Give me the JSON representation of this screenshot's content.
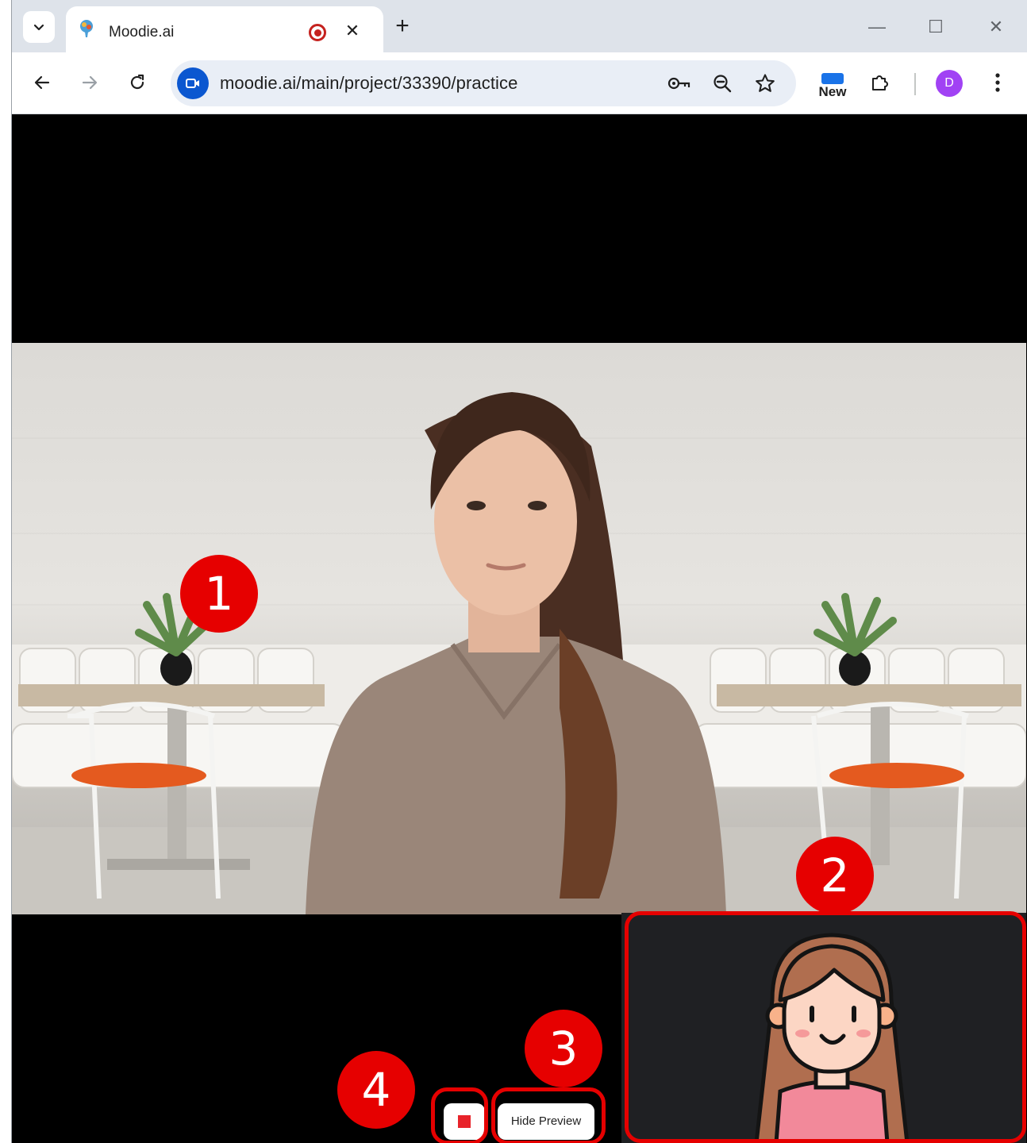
{
  "browser": {
    "tab": {
      "title": "Moodie.ai",
      "close_glyph": "✕"
    },
    "new_tab_glyph": "+",
    "window_controls": {
      "minimize": "—",
      "maximize": "☐",
      "close": "✕"
    },
    "toolbar": {
      "url": "moodie.ai/main/project/33390/practice",
      "new_badge_label": "New",
      "profile_initial": "D"
    }
  },
  "annotations": {
    "marker_1": "1",
    "marker_2": "2",
    "marker_3": "3",
    "marker_4": "4"
  },
  "video_controls": {
    "hide_preview_label": "Hide Preview"
  },
  "colors": {
    "annotation_red": "#e60000",
    "stop_red": "#e8232a",
    "site_badge_blue": "#0b57d0",
    "profile_purple": "#a142f4"
  },
  "icons": {
    "tab_search": "chevron-down-icon",
    "favicon": "moodie-favicon-icon",
    "recording": "recording-icon",
    "back": "arrow-left-icon",
    "forward": "arrow-right-icon",
    "reload": "reload-icon",
    "site": "video-camera-icon",
    "password": "key-icon",
    "zoom": "zoom-out-icon",
    "bookmark": "star-icon",
    "extensions": "puzzle-icon",
    "menu": "kebab-menu-icon",
    "stop": "stop-icon"
  }
}
